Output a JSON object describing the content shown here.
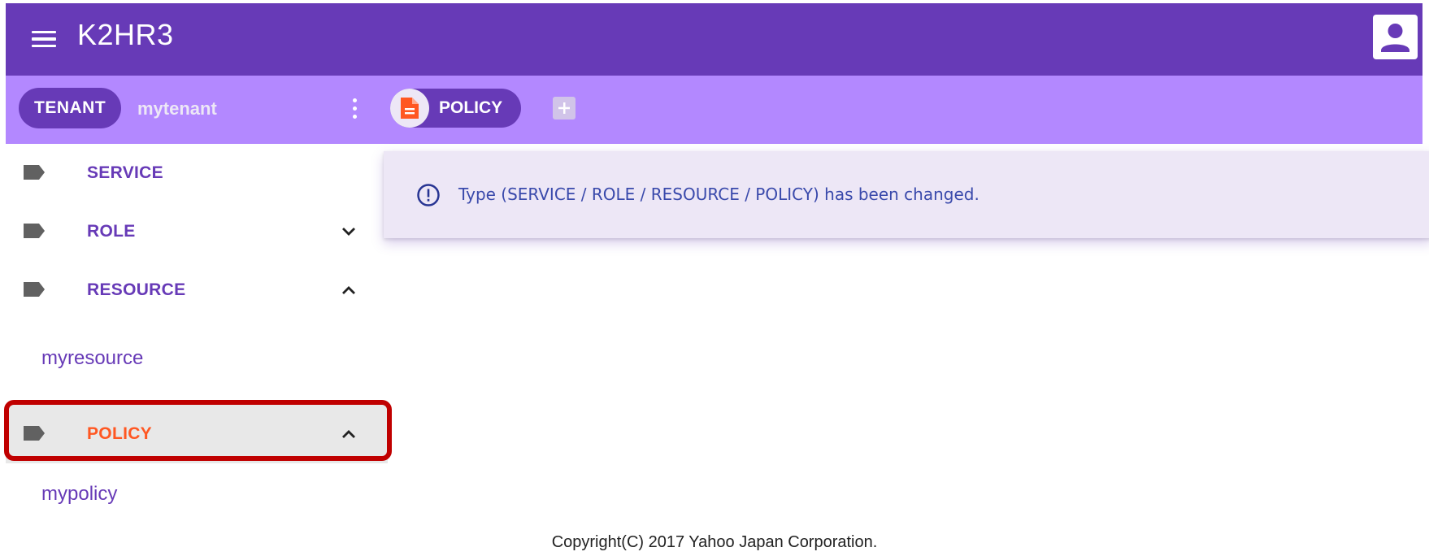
{
  "app": {
    "title": "K2HR3"
  },
  "header": {
    "menu_icon": "menu-icon",
    "account_icon": "account-icon"
  },
  "toolbar": {
    "tenant_chip": "TENANT",
    "tenant_name": "mytenant",
    "type_chip": "POLICY",
    "type_chip_icon": "document-icon",
    "add_icon": "plus-icon"
  },
  "sidebar": {
    "items": [
      {
        "label": "SERVICE",
        "expanded": null
      },
      {
        "label": "ROLE",
        "expanded": false
      },
      {
        "label": "RESOURCE",
        "expanded": true,
        "children": [
          "myresource"
        ]
      },
      {
        "label": "POLICY",
        "expanded": true,
        "selected": true,
        "children": [
          "mypolicy"
        ]
      }
    ]
  },
  "message": {
    "text": "Type (SERVICE / ROLE / RESOURCE / POLICY) has been changed.",
    "icon": "info-icon"
  },
  "footer": {
    "copyright": "Copyright(C) 2017 Yahoo Japan Corporation."
  },
  "colors": {
    "primary": "#673ab7",
    "toolbar": "#b388ff",
    "selected_label": "#ff5722",
    "highlight": "#c00000",
    "message_bg": "#ede7f6",
    "message_text": "#3949ab"
  }
}
